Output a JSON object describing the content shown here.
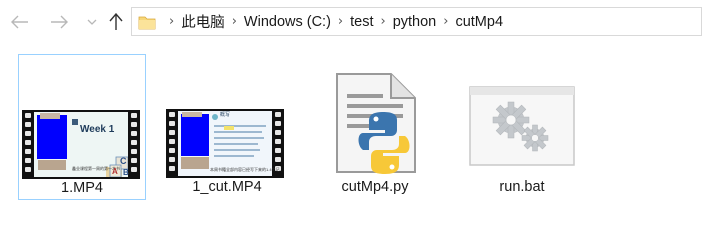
{
  "nav": {
    "back_icon": "arrow-left-icon",
    "forward_icon": "arrow-right-icon",
    "recent_icon": "chevron-down-icon",
    "up_icon": "arrow-up-icon"
  },
  "address": {
    "folder_icon": "folder-icon",
    "breadcrumbs": [
      "此电脑",
      "Windows (C:)",
      "test",
      "python",
      "cutMp4"
    ]
  },
  "files": [
    {
      "name": "1.MP4",
      "type": "video",
      "selected": true,
      "thumb_text": "Week 1",
      "thumb_caption": "鑫业课程第一周的第一本书",
      "thumb_letters": [
        "A",
        "B",
        "C"
      ]
    },
    {
      "name": "1_cut.MP4",
      "type": "video",
      "selected": false,
      "thumb_text": "概写",
      "thumb_caption": "本周书籍全部内容已经写下来的1.4个记"
    },
    {
      "name": "cutMp4.py",
      "type": "python-script",
      "selected": false
    },
    {
      "name": "run.bat",
      "type": "batch-file",
      "selected": false
    }
  ],
  "colors": {
    "selection_border": "#99d1ff",
    "python_blue": "#3b75ae",
    "python_yellow": "#f7c838",
    "blue_redaction": "#0000ff"
  }
}
